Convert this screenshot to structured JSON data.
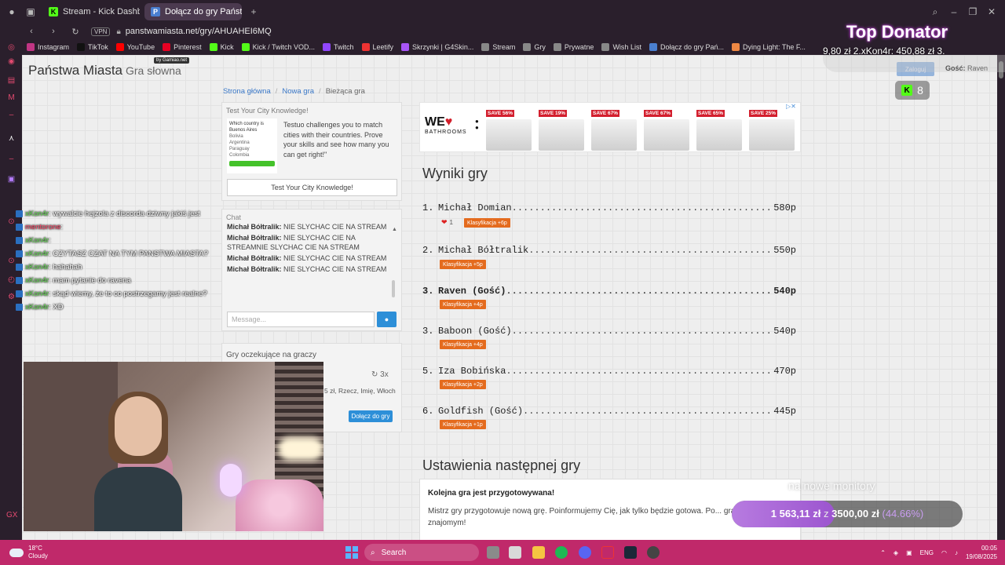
{
  "browser": {
    "tabs": [
      {
        "label": "Stream - Kick Dashboard",
        "active": false
      },
      {
        "label": "Dołącz do gry Państwa M",
        "active": true
      }
    ],
    "vpn_label": "VPN",
    "url": "panstwamiasta.net/gry/AHUAHEI6MQ",
    "bookmarks": [
      "Instagram",
      "TikTok",
      "YouTube",
      "Pinterest",
      "Kick",
      "Kick / Twitch VOD...",
      "Twitch",
      "Leetify",
      "Skrzynki | G4Skin...",
      "Stream",
      "Gry",
      "Prywatne",
      "Wish List",
      "Dołącz do gry Pań...",
      "Dying Light: The F..."
    ]
  },
  "site": {
    "title": "Państwa Miasta",
    "subtitle": "Gra słowna",
    "badge": "by Gamiao.net",
    "breadcrumbs": [
      "Strona główna",
      "Nowa gra",
      "Bieżąca gra"
    ]
  },
  "ad": {
    "title": "Test Your City Knowledge!",
    "quiz_q": "Which country is Buenos Aires",
    "quiz_options": [
      "Bolivia",
      "Argentina",
      "Paraguay",
      "Colombia"
    ],
    "text": "Testuo challenges you to match cities with their countries. Prove your skills and see how many you can get right!\"",
    "button": "Test Your City Knowledge!"
  },
  "chat": {
    "title": "Chat",
    "messages": [
      {
        "user": "Michał Bółtralik:",
        "text": "NIE SLYCHAC CIE NA STREAM"
      },
      {
        "user": "Michał Bółtralik:",
        "text": "NIE SLYCHAC CIE NA STREAMNIE SLYCHAC CIE NA STREAM"
      },
      {
        "user": "Michał Bółtralik:",
        "text": "NIE SLYCHAC CIE NA STREAM"
      },
      {
        "user": "Michał Bółtralik:",
        "text": "NIE SLYCHAC CIE NA STREAM"
      }
    ],
    "placeholder": "Message..."
  },
  "waiting": {
    "title": "Gry oczekujące na graczy",
    "count": "3x",
    "desc": "5 zł, Rzecz, Imię, Włoch",
    "join": "Dołącz do gry"
  },
  "banner": {
    "logo_we": "WE",
    "logo_sub": "BATHROOMS",
    "saves": [
      "SAVE 56%",
      "SAVE 19%",
      "SAVE 67%",
      "SAVE 67%",
      "SAVE 65%",
      "SAVE 25%"
    ]
  },
  "results": {
    "title": "Wyniki gry",
    "rows": [
      {
        "rank": "1.",
        "name": "Michał Domian",
        "points": "580p",
        "badge": "Klasyfikacja +6p",
        "likes": "1",
        "bold": false
      },
      {
        "rank": "2.",
        "name": "Michał Bółtralik",
        "points": "550p",
        "badge": "Klasyfikacja +5p",
        "bold": false
      },
      {
        "rank": "3.",
        "name": "Raven (Gość)",
        "points": "540p",
        "badge": "Klasyfikacja +4p",
        "bold": true
      },
      {
        "rank": "3.",
        "name": "Baboon (Gość)",
        "points": "540p",
        "badge": "Klasyfikacja +4p",
        "bold": false
      },
      {
        "rank": "5.",
        "name": "Iza Bobińska",
        "points": "470p",
        "badge": "Klasyfikacja +2p",
        "bold": false
      },
      {
        "rank": "6.",
        "name": "Goldfish (Gość)",
        "points": "445p",
        "badge": "Klasyfikacja +1p",
        "bold": false
      }
    ]
  },
  "settings": {
    "title": "Ustawienia następnej gry",
    "box_title": "Kolejna gra jest przygotowywana!",
    "box_text": "Mistrz gry przygotowuje nową grę. Poinformujemy Cię, jak tylko będzie gotowa. Po... gra? Udostępnij ją znajomym!"
  },
  "header_right": {
    "login": "Zaloguj",
    "guest_label": "Gość:",
    "guest_name": "Raven"
  },
  "overlay": {
    "chat": [
      {
        "user": "xKon4r",
        "text": ": wywalcie hejzola z discorda dziwny jakiś jest"
      },
      {
        "user": "mentorone",
        "text": ":",
        "alt": true
      },
      {
        "user": "xKon4r",
        "text": ":"
      },
      {
        "user": "xKon4r",
        "text": ": CZYTASZ CZAT NA TYM PANSTWA MIASTA?"
      },
      {
        "user": "xKon4r",
        "text": ": hahahah"
      },
      {
        "user": "xKon4r",
        "text": ": mam pytanie do ravena"
      },
      {
        "user": "xKon4r",
        "text": ": skąd wiemy, że to co postrzegamy jest realne?"
      },
      {
        "user": "xKon4r",
        "text": ": XD"
      }
    ],
    "top_donator_title": "Top Donator",
    "top_donator_line": "9,80 zł    2.xKon4r: 450,88 zł    3.",
    "viewers": "8",
    "goal_label": "na nowe monitory",
    "goal_current": "1 563,11 zł",
    "goal_sep": "z",
    "goal_target": "3500,00 zł",
    "goal_pct": "(44.66%)",
    "goal_fraction": 0.4466
  },
  "taskbar": {
    "temp": "18°C",
    "weather": "Cloudy",
    "search": "Search",
    "lang": "ENG",
    "time": "00:05",
    "date": "19/08/2025"
  },
  "colors": {
    "taskbar": "#c0296a",
    "klasyfikacja": "#e46b1e",
    "link": "#3a78c8"
  }
}
